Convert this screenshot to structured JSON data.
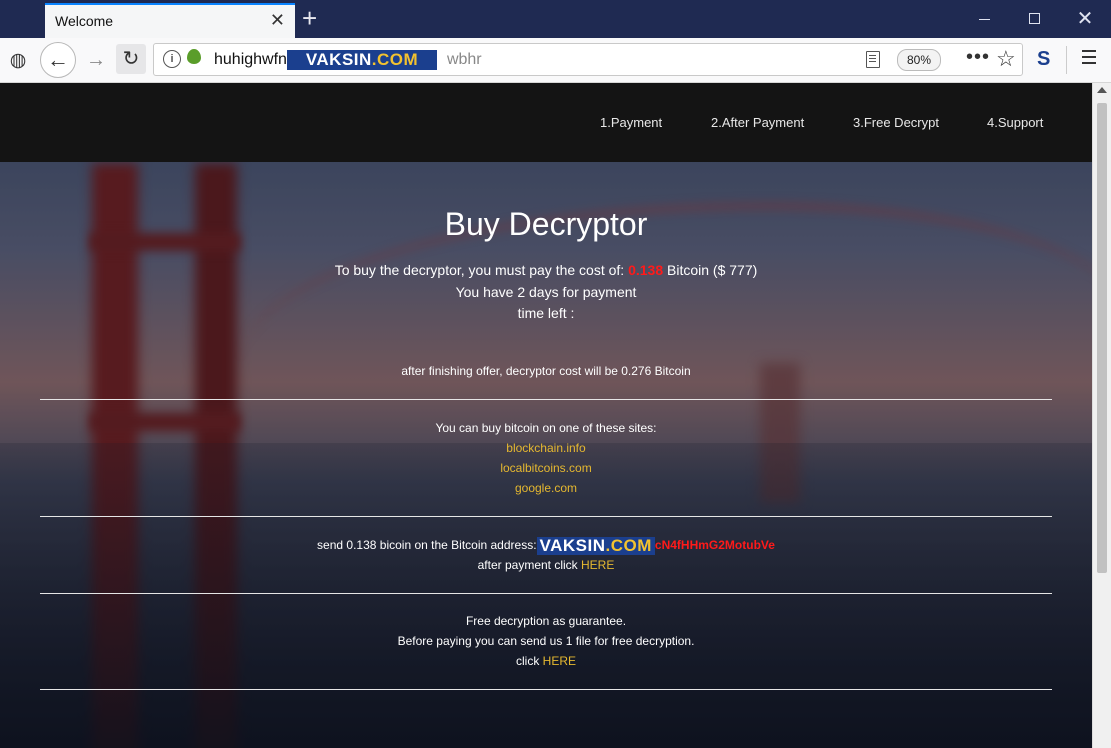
{
  "browser": {
    "tab_title": "Welcome",
    "url_start": "huhighwfn",
    "url_end": "wbhr",
    "url_mask": {
      "left": "VAKSIN",
      "right": ".COM"
    },
    "zoom": "80%"
  },
  "site": {
    "menu": [
      "1.Payment",
      "2.After Payment",
      "3.Free Decrypt",
      "4.Support"
    ],
    "title": "Buy Decryptor",
    "cost_prefix": "To buy the decryptor, you must pay the cost of:",
    "cost_btc": "0.138",
    "cost_suffix": "Bitcoin ($ 777)",
    "days_line": "You have 2 days for payment",
    "time_left": "time left :",
    "after_offer": "after finishing offer, decryptor cost will be 0.276 Bitcoin",
    "buy_intro": "You can buy bitcoin on one of these sites:",
    "sites": [
      "blockchain.info",
      "localbitcoins.com",
      "google.com"
    ],
    "send_prefix": "send 0.138 bicoin on the Bitcoin address:",
    "address_mask": {
      "left": "VAKSIN",
      "right": ".COM"
    },
    "address_tail": "cN4fHHmG2MotubVe",
    "after_payment_prefix": "after payment click",
    "here_1": "HERE",
    "free_line1": "Free decryption as guarantee.",
    "free_line2": "Before paying you can send us 1 file for free decryption.",
    "click_prefix": "click",
    "here_2": "HERE"
  },
  "colors": {
    "accent_red": "#ff1a1a",
    "link_gold": "#e5b830",
    "header_bg": "#141414"
  },
  "icons": [
    "tor-icon",
    "back-icon",
    "forward-icon",
    "reload-icon",
    "info-icon",
    "onion-icon",
    "reader-view-icon",
    "more-icon",
    "bookmark-star-icon",
    "s-addon-icon",
    "hamburger-menu-icon"
  ]
}
